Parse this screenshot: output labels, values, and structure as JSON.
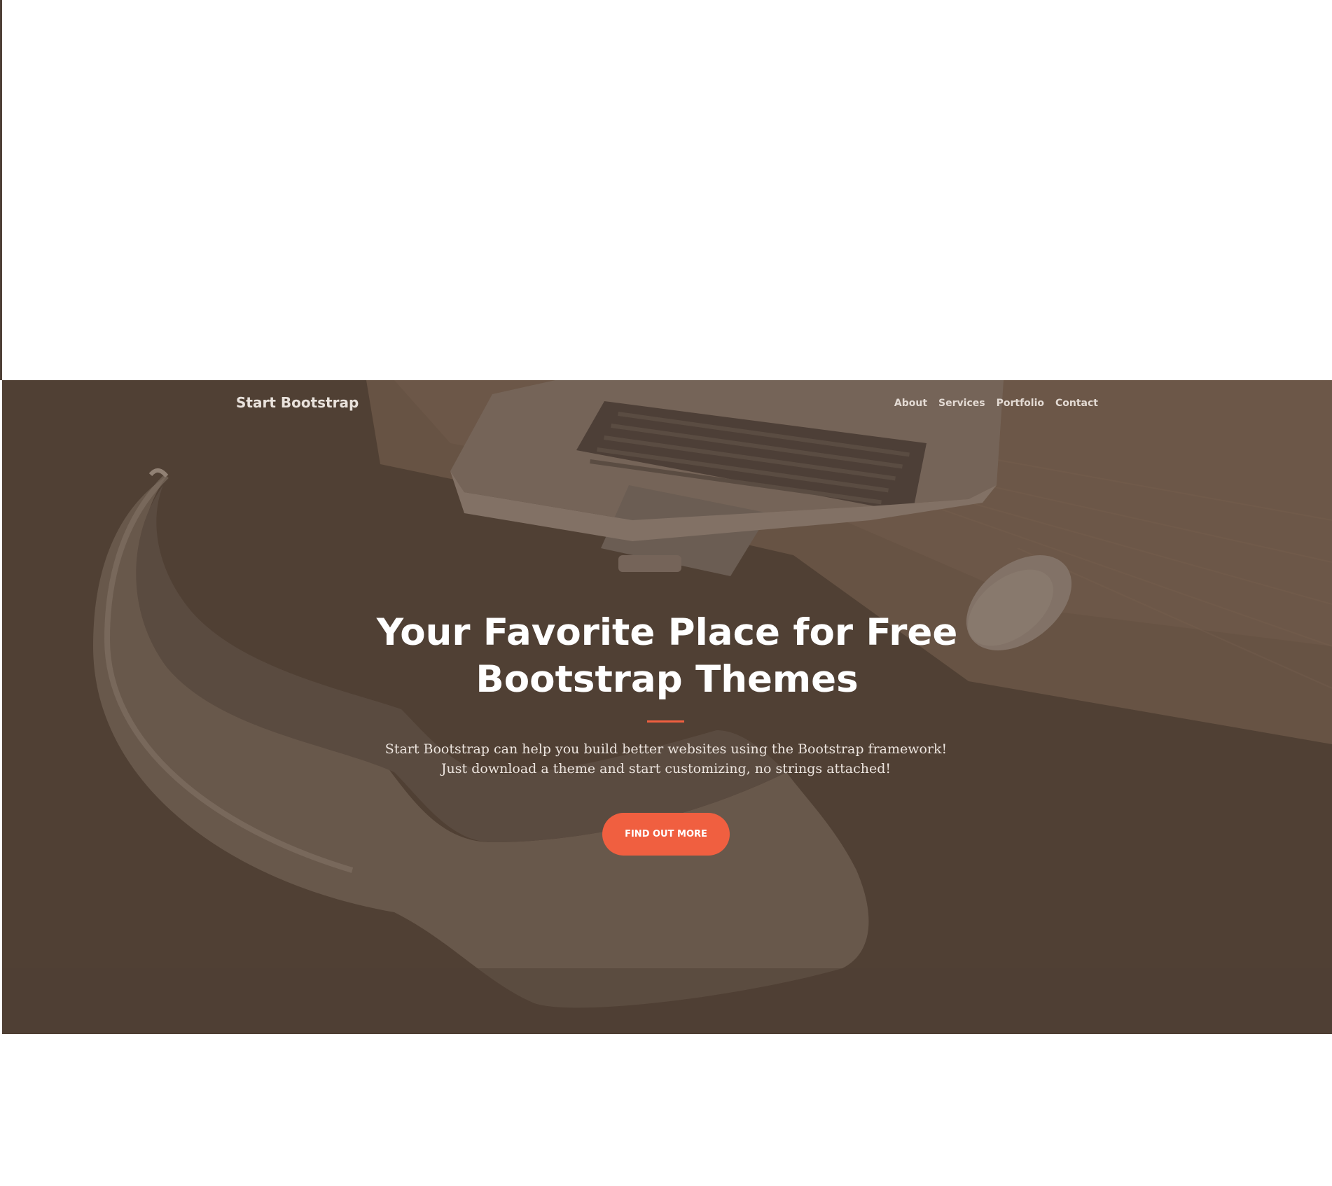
{
  "navbar": {
    "brand": "Start Bootstrap",
    "links": [
      "About",
      "Services",
      "Portfolio",
      "Contact"
    ]
  },
  "hero": {
    "title_line_1": "Your Favorite Place for Free",
    "title_line_2": "Bootstrap Themes",
    "lead": "Start Bootstrap can help you build better websites using the Bootstrap framework! Just download a theme and start customizing, no strings attached!",
    "cta_label": "FIND OUT MORE"
  },
  "colors": {
    "overlay": "#4f4035",
    "accent": "#f05f40",
    "text_light": "#ffffff"
  }
}
